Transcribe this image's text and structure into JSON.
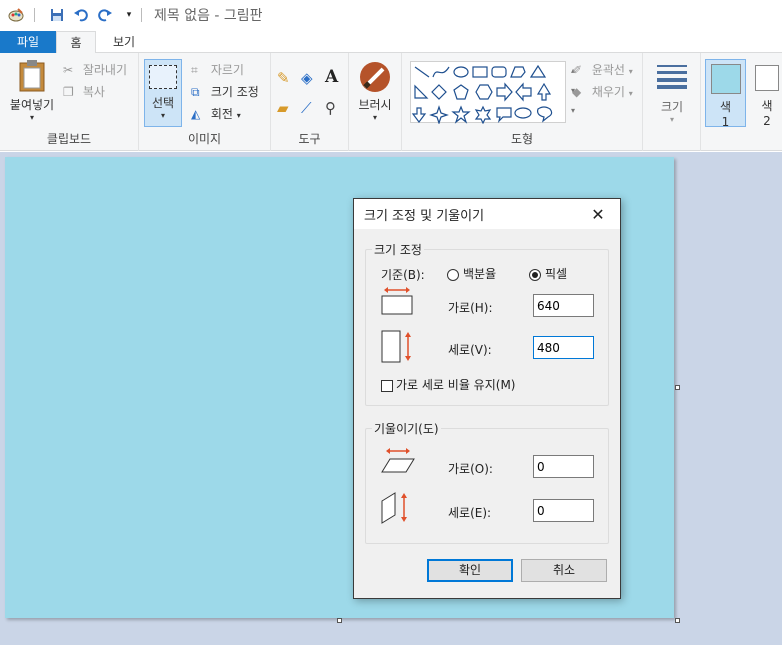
{
  "window": {
    "title": "제목 없음 - 그림판"
  },
  "tabs": [
    {
      "label": "파일"
    },
    {
      "label": "홈"
    },
    {
      "label": "보기"
    }
  ],
  "ribbon": {
    "clipboard": {
      "label": "클립보드",
      "paste": "붙여넣기",
      "cut": "잘라내기",
      "copy": "복사"
    },
    "image": {
      "label": "이미지",
      "select": "선택",
      "crop": "자르기",
      "resize": "크기 조정",
      "rotate": "회전"
    },
    "tools": {
      "label": "도구",
      "brushes": "브러시"
    },
    "shapes": {
      "label": "도형",
      "outline": "윤곽선",
      "fill": "채우기"
    },
    "size": {
      "label": "크기"
    },
    "colors": {
      "color1": "색\n1",
      "color1_a": "색",
      "color1_b": "1",
      "color2_a": "색",
      "color2_b": "2",
      "color1_value": "#9dd9e9",
      "color2_value": "#ffffff"
    }
  },
  "dialog": {
    "title": "크기 조정 및 기울이기",
    "resize_group": "크기 조정",
    "basis_label": "기준(B):",
    "option_percent": "백분율",
    "option_pixel": "픽셀",
    "selected_option": "픽셀",
    "horizontal_label": "가로(H):",
    "horizontal_value": "640",
    "vertical_label": "세로(V):",
    "vertical_value": "480",
    "keep_ratio_label": "가로 세로 비율 유지(M)",
    "keep_ratio_checked": false,
    "skew_group": "기울이기(도)",
    "skew_horizontal_label": "가로(O):",
    "skew_horizontal_value": "0",
    "skew_vertical_label": "세로(E):",
    "skew_vertical_value": "0",
    "ok": "확인",
    "cancel": "취소"
  },
  "colors": {
    "canvas": "#9dd9e9",
    "workspace": "#cad5e7",
    "accent": "#1979ca",
    "arrow": "#e0502a"
  }
}
